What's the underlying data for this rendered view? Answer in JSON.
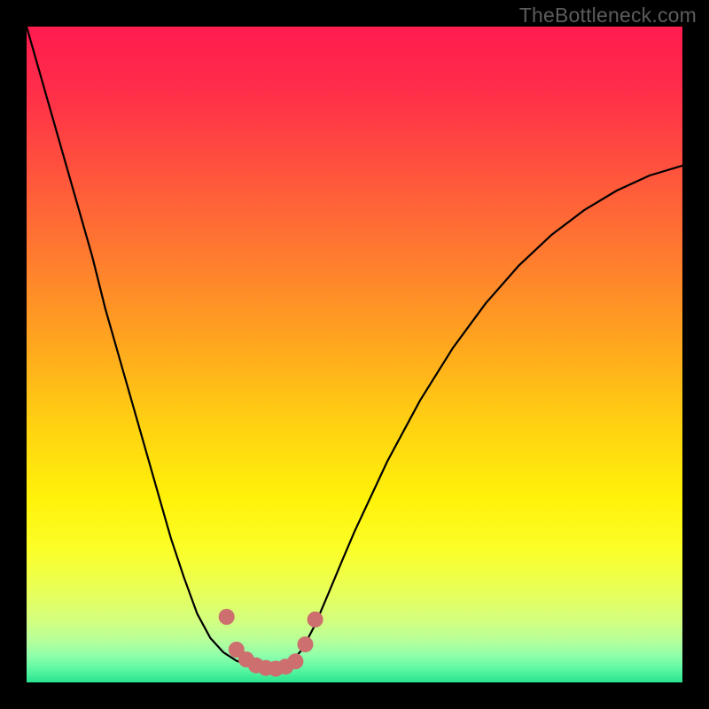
{
  "watermark": "TheBottleneck.com",
  "gradient_stops": [
    {
      "offset": 0.0,
      "color": "#ff1b4f"
    },
    {
      "offset": 0.1,
      "color": "#ff2e49"
    },
    {
      "offset": 0.22,
      "color": "#ff533d"
    },
    {
      "offset": 0.35,
      "color": "#ff7b2f"
    },
    {
      "offset": 0.48,
      "color": "#ffa51f"
    },
    {
      "offset": 0.6,
      "color": "#ffcf12"
    },
    {
      "offset": 0.72,
      "color": "#fff20a"
    },
    {
      "offset": 0.8,
      "color": "#fbff2a"
    },
    {
      "offset": 0.86,
      "color": "#e8ff58"
    },
    {
      "offset": 0.905,
      "color": "#d4ff7e"
    },
    {
      "offset": 0.935,
      "color": "#b8ff9a"
    },
    {
      "offset": 0.96,
      "color": "#8dffab"
    },
    {
      "offset": 0.98,
      "color": "#5cf7a3"
    },
    {
      "offset": 1.0,
      "color": "#29e38f"
    }
  ],
  "marker_color": "#cc6f6e",
  "chart_data": {
    "type": "line",
    "title": "",
    "xlabel": "",
    "ylabel": "",
    "x": [
      0.0,
      0.02,
      0.04,
      0.06,
      0.08,
      0.1,
      0.12,
      0.14,
      0.16,
      0.18,
      0.2,
      0.22,
      0.24,
      0.26,
      0.28,
      0.3,
      0.32,
      0.34,
      0.36,
      0.38,
      0.4,
      0.42,
      0.44,
      0.46,
      0.48,
      0.5,
      0.55,
      0.6,
      0.65,
      0.7,
      0.75,
      0.8,
      0.85,
      0.9,
      0.95,
      1.0
    ],
    "values": [
      1.0,
      0.93,
      0.86,
      0.79,
      0.72,
      0.65,
      0.57,
      0.5,
      0.43,
      0.36,
      0.29,
      0.22,
      0.16,
      0.105,
      0.068,
      0.046,
      0.033,
      0.026,
      0.022,
      0.021,
      0.027,
      0.05,
      0.088,
      0.135,
      0.183,
      0.23,
      0.337,
      0.43,
      0.51,
      0.578,
      0.635,
      0.682,
      0.72,
      0.75,
      0.773,
      0.788
    ],
    "xlim": [
      0,
      1
    ],
    "ylim": [
      0,
      1
    ],
    "marker_points_x": [
      0.305,
      0.32,
      0.335,
      0.35,
      0.365,
      0.38,
      0.395,
      0.41,
      0.425,
      0.44
    ],
    "marker_points_y": [
      0.1,
      0.05,
      0.035,
      0.026,
      0.022,
      0.021,
      0.024,
      0.032,
      0.058,
      0.096
    ]
  }
}
